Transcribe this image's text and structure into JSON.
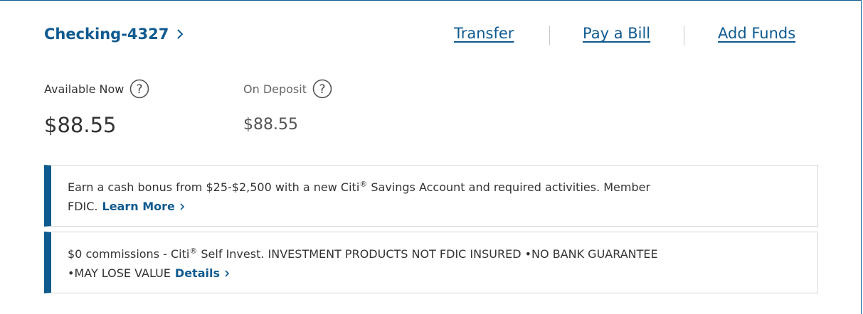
{
  "account": {
    "title": "Checking-4327",
    "actions": {
      "transfer": "Transfer",
      "pay_bill": "Pay a Bill",
      "add_funds": "Add Funds"
    },
    "available_label": "Available Now",
    "available_amount": "$88.55",
    "deposit_label": "On Deposit",
    "deposit_amount": "$88.55"
  },
  "promos": [
    {
      "text_before": "Earn a cash bonus from $25-$2,500 with a new Citi",
      "sup": "®",
      "text_after": " Savings Account and required activities. Member",
      "line2": "FDIC.",
      "cta": "Learn More"
    },
    {
      "text_before": "$0 commissions - Citi",
      "sup": "®",
      "text_after": " Self Invest. INVESTMENT PRODUCTS NOT FDIC INSURED •NO BANK GUARANTEE",
      "line2": "•MAY LOSE VALUE",
      "cta": "Details"
    }
  ],
  "colors": {
    "brand": "#0f5a8f",
    "text": "#333333",
    "border": "#d6d6d6"
  },
  "icons": [
    "chevron-right-icon",
    "help-icon"
  ]
}
